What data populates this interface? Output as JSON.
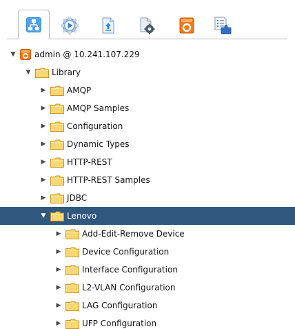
{
  "toolbar": {
    "tabs": [
      {
        "icon": "network-tree-icon",
        "active": true
      },
      {
        "icon": "gear-play-icon",
        "active": false
      },
      {
        "icon": "document-upload-icon",
        "active": false
      },
      {
        "icon": "document-gear-icon",
        "active": false
      },
      {
        "icon": "orange-server-icon",
        "active": false
      },
      {
        "icon": "checklist-puzzle-icon",
        "active": false
      }
    ]
  },
  "tree": {
    "server": {
      "label": "admin @ 10.241.107.229",
      "icon": "server-icon"
    },
    "library": {
      "label": "Library"
    },
    "items": [
      {
        "label": "AMQP"
      },
      {
        "label": "AMQP Samples"
      },
      {
        "label": "Configuration"
      },
      {
        "label": "Dynamic Types"
      },
      {
        "label": "HTTP-REST"
      },
      {
        "label": "HTTP-REST Samples"
      },
      {
        "label": "JDBC"
      },
      {
        "label": "Lenovo",
        "selected": true,
        "expanded": true
      }
    ],
    "lenovo_children": [
      {
        "label": "Add-Edit-Remove Device"
      },
      {
        "label": "Device Configuration"
      },
      {
        "label": "Interface Configuration"
      },
      {
        "label": "L2-VLAN Configuration"
      },
      {
        "label": "LAG Configuration"
      },
      {
        "label": "UFP Configuration"
      }
    ]
  },
  "colors": {
    "selection": "#30577e",
    "folder_fill": "#f8d774",
    "folder_stroke": "#c9962b",
    "server_orange": "#f07a1b"
  }
}
